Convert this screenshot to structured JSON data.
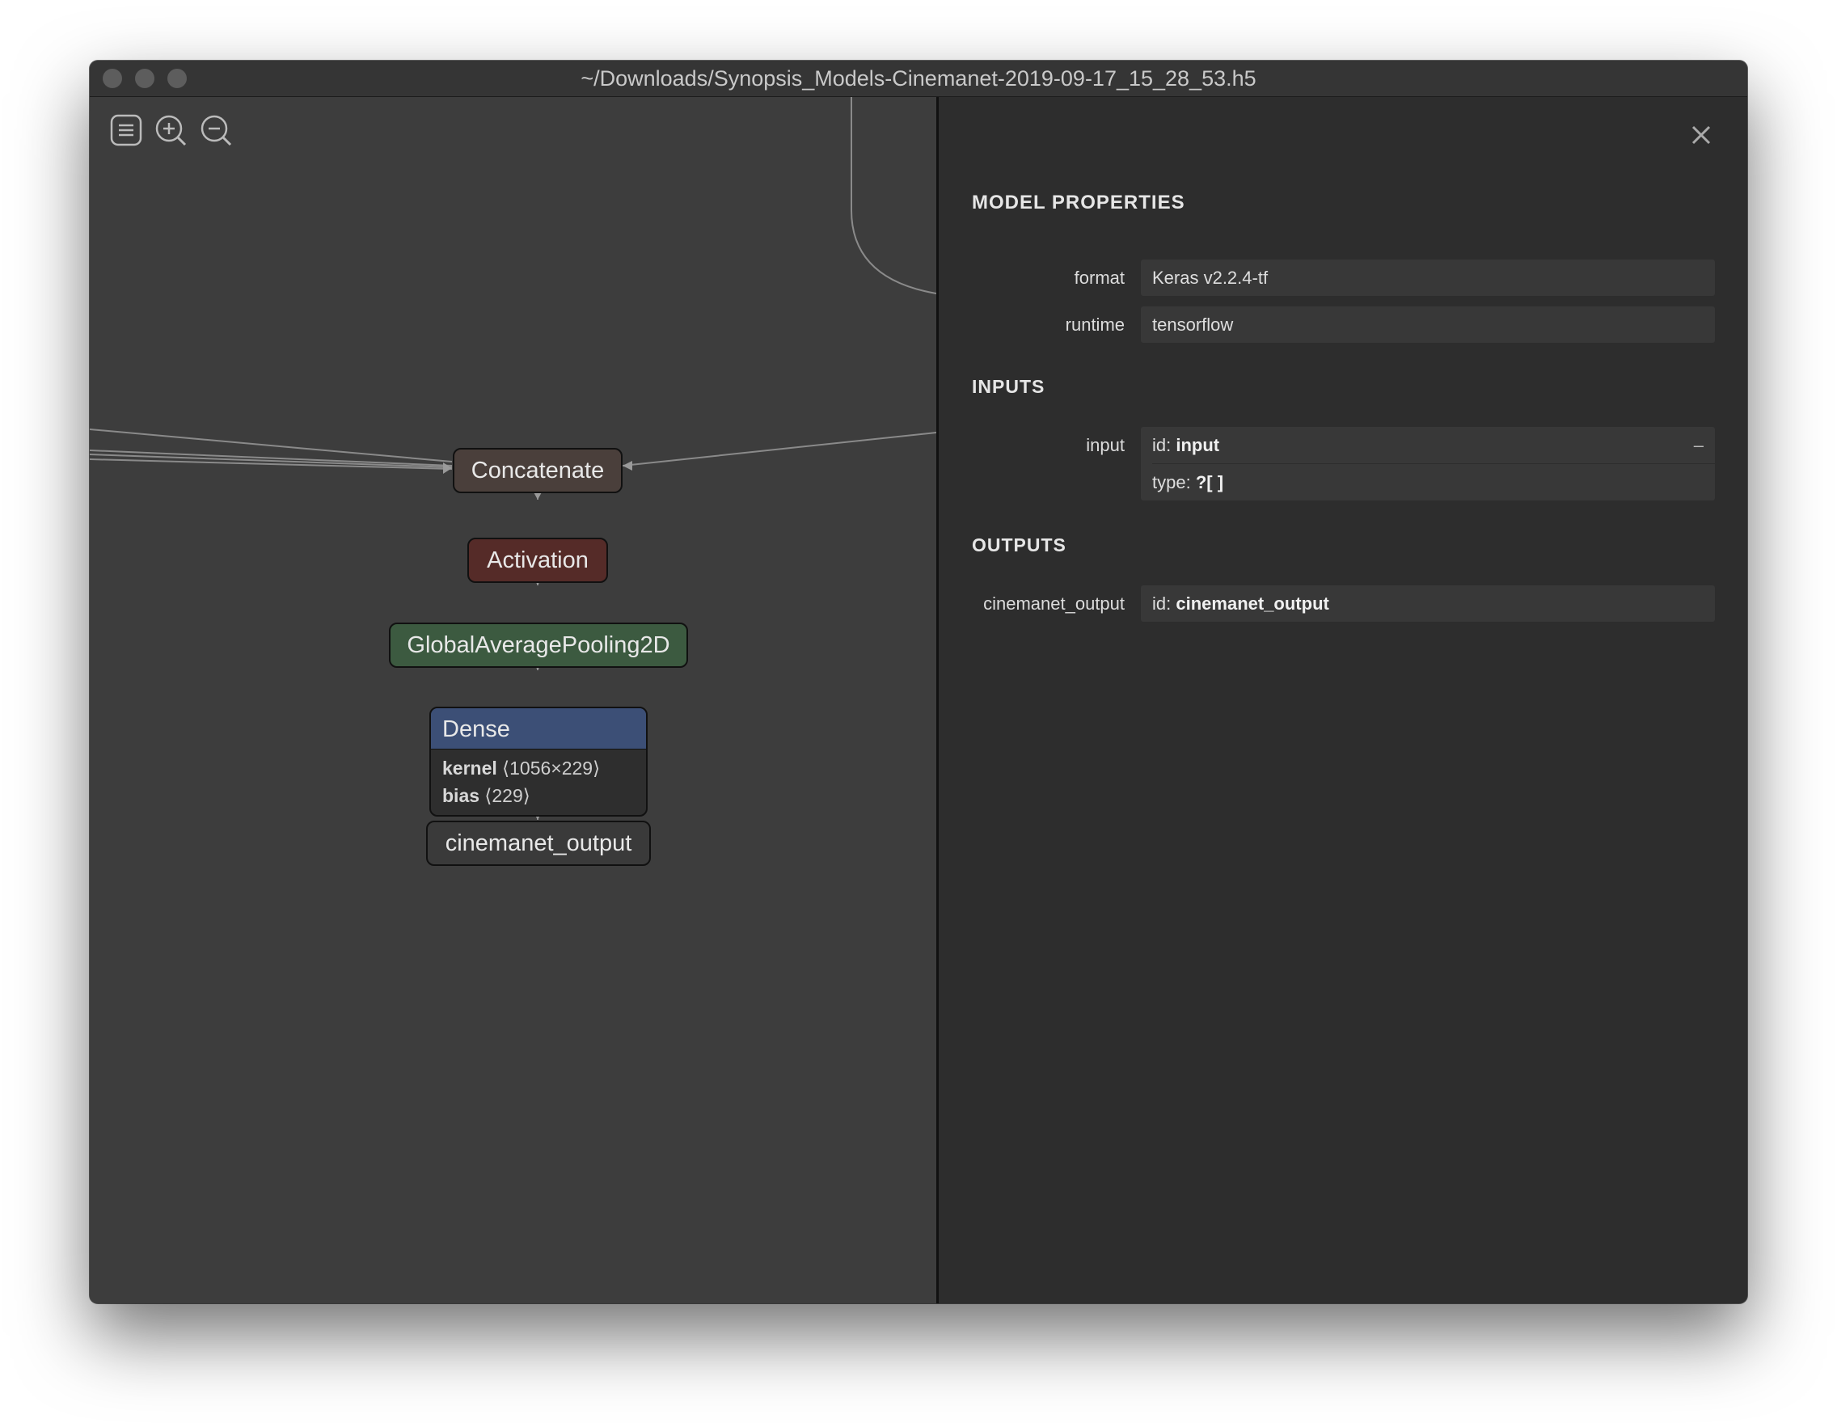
{
  "window": {
    "title": "~/Downloads/Synopsis_Models-Cinemanet-2019-09-17_15_28_53.h5"
  },
  "toolbar": {
    "icons": [
      "menu-icon",
      "zoom-in-icon",
      "zoom-out-icon"
    ]
  },
  "graph": {
    "nodes": {
      "concatenate": "Concatenate",
      "activation": "Activation",
      "pooling": "GlobalAveragePooling2D",
      "dense": "Dense",
      "output": "cinemanet_output"
    },
    "dense_attrs": {
      "kernel_name": "kernel",
      "kernel_shape": "⟨1056×229⟩",
      "bias_name": "bias",
      "bias_shape": "⟨229⟩"
    },
    "colors": {
      "concatenate": "#4a3f3b",
      "activation": "#552b28",
      "pooling": "#3c5a40",
      "dense_header": "#3c4f76",
      "output": "#3a3a3a"
    }
  },
  "sidebar": {
    "title": "MODEL PROPERTIES",
    "properties": {
      "format_label": "format",
      "format_value": "Keras v2.2.4-tf",
      "runtime_label": "runtime",
      "runtime_value": "tensorflow"
    },
    "inputs": {
      "heading": "INPUTS",
      "label": "input",
      "id_prefix": "id:",
      "id_value": "input",
      "collapse": "–",
      "type_prefix": "type:",
      "type_value": "?[ ]"
    },
    "outputs": {
      "heading": "OUTPUTS",
      "label": "cinemanet_output",
      "id_prefix": "id:",
      "id_value": "cinemanet_output"
    }
  }
}
